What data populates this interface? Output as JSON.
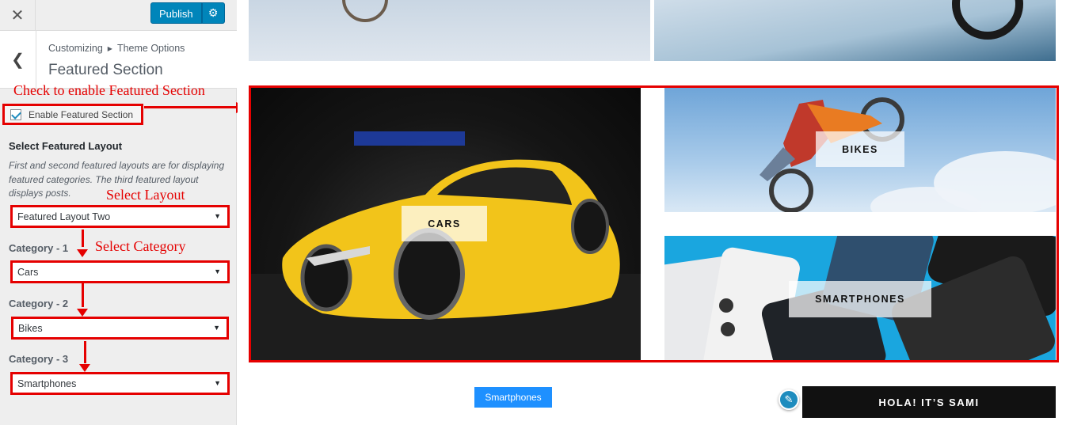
{
  "topbar": {
    "close_icon": "close-icon",
    "publish_label": "Publish",
    "gear_icon": "gear-icon"
  },
  "section": {
    "breadcrumb_root": "Customizing",
    "breadcrumb_child": "Theme Options",
    "title": "Featured Section"
  },
  "annotations": {
    "check": "Check to enable Featured Section",
    "select_layout": "Select Layout",
    "select_category": "Select Category"
  },
  "form": {
    "enable_label": "Enable Featured Section",
    "enable_checked": true,
    "layout_heading": "Select Featured Layout",
    "layout_description": "First and second featured layouts are for displaying featured categories. The third featured layout displays posts.",
    "layout_value": "Featured Layout Two",
    "category1_label": "Category - 1",
    "category1_value": "Cars",
    "category2_label": "Category - 2",
    "category2_value": "Bikes",
    "category3_label": "Category - 3",
    "category3_value": "Smartphones"
  },
  "preview": {
    "featured": [
      {
        "label": "CARS"
      },
      {
        "label": "BIKES"
      },
      {
        "label": "SMARTPHONES"
      }
    ],
    "tag_label": "Smartphones",
    "edit_icon": "pencil-icon",
    "hola_label": "HOLA! IT’S SAMI"
  },
  "colors": {
    "accent": "#0085ba",
    "annotation_red": "#e50000",
    "tag_blue": "#1e90ff"
  }
}
